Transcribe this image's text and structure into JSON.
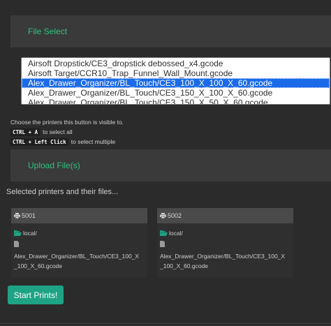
{
  "file_select": {
    "title": "File Select",
    "options": [
      "Airsoft Dropstick/CE3_dropstick debossed_x4.gcode",
      "Airsoft Target/CCR10_Trap_Funnel_Wall_Mount.gcode",
      "Alex_Drawer_Organizer/BL_Touch/CE3_100_X_100_X_60.gcode",
      "Alex_Drawer_Organizer/BL_Touch/CE3_150_X_100_X_60.gcode",
      "Alex_Drawer_Organizer/BL_Touch/CE3_150_X_50_X_60.gcode"
    ],
    "selected_index": 2
  },
  "hints": {
    "line1": "Choose the printers this button is visible to.",
    "ctrl_a_key": "CTRL + A",
    "ctrl_a_text": "to select all",
    "ctrl_click_key": "CTRL + Left Click",
    "ctrl_click_text": "to select multiple"
  },
  "upload": {
    "title": "Upload File(s)"
  },
  "selected_heading": "Selected printers and their files...",
  "printers": [
    {
      "port": "5001",
      "folder": "local/",
      "file": "Alex_Drawer_Organizer/BL_Touch/CE3_100_X_100_X_60.gcode"
    },
    {
      "port": "5002",
      "folder": "local/",
      "file": "Alex_Drawer_Organizer/BL_Touch/CE3_100_X_100_X_60.gcode"
    }
  ],
  "start_button": "Start Prints!",
  "colors": {
    "background": "#2b2b2b",
    "panel": "#3a3a3a",
    "accent_text": "#2ec27e",
    "selection": "#1b6ae8",
    "button": "#1ea385"
  },
  "icons": {
    "printer": "printer-icon",
    "folder": "folder-open-icon",
    "file": "file-icon"
  }
}
